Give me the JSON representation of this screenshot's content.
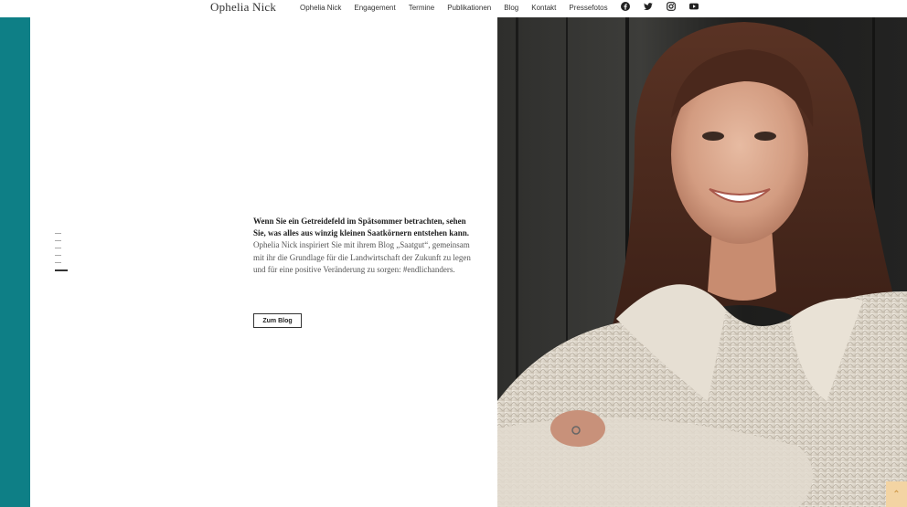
{
  "brand": "Ophelia Nick",
  "nav": [
    "Ophelia Nick",
    "Engagement",
    "Termine",
    "Publikationen",
    "Blog",
    "Kontakt",
    "Pressefotos"
  ],
  "social": [
    "facebook-icon",
    "twitter-icon",
    "instagram-icon",
    "youtube-icon"
  ],
  "intro": {
    "lead": "Wenn Sie ein Getreidefeld im Spätsommer betrachten, sehen Sie, was alles aus winzig kleinen Saatkörnern entstehen kann.",
    "body": "Ophelia Nick inspiriert Sie mit ihrem Blog „Saatgut“, gemeinsam mit ihr die Grundlage für die Landwirtschaft der Zukunft zu legen und für eine positive Veränderung zu sorgen: #endlichanders."
  },
  "button": "Zum Blog",
  "slides": 6,
  "active_slide": 6,
  "colors": {
    "accent": "#0e7f86",
    "scrolltop": "#f3d4a3"
  }
}
